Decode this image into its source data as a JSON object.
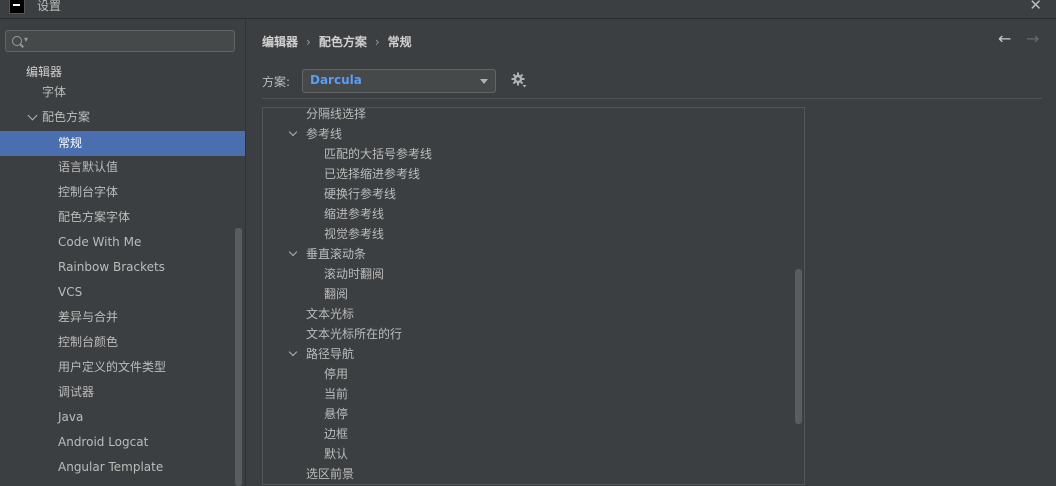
{
  "window": {
    "title": "设置"
  },
  "sidebar": {
    "search": {
      "placeholder": "",
      "value": ""
    },
    "items": [
      {
        "label": "编辑器"
      },
      {
        "label": "字体"
      },
      {
        "label": "配色方案"
      },
      {
        "label": "常规"
      },
      {
        "label": "语言默认值"
      },
      {
        "label": "控制台字体"
      },
      {
        "label": "配色方案字体"
      },
      {
        "label": "Code With Me"
      },
      {
        "label": "Rainbow Brackets"
      },
      {
        "label": "VCS"
      },
      {
        "label": "差异与合并"
      },
      {
        "label": "控制台颜色"
      },
      {
        "label": "用户定义的文件类型"
      },
      {
        "label": "调试器"
      },
      {
        "label": "Java"
      },
      {
        "label": "Android Logcat"
      },
      {
        "label": "Angular Template"
      }
    ],
    "selected": "常规"
  },
  "header": {
    "breadcrumb": [
      "编辑器",
      "配色方案",
      "常规"
    ],
    "separator": "›",
    "back_icon": "←",
    "forward_icon": "→"
  },
  "scheme": {
    "label": "方案:",
    "value": "Darcula"
  },
  "tree": {
    "items": [
      {
        "label": "分隔线选择"
      },
      {
        "label": "参考线"
      },
      {
        "label": "匹配的大括号参考线"
      },
      {
        "label": "已选择缩进参考线"
      },
      {
        "label": "硬换行参考线"
      },
      {
        "label": "缩进参考线"
      },
      {
        "label": "视觉参考线"
      },
      {
        "label": "垂直滚动条"
      },
      {
        "label": "滚动时翻阅"
      },
      {
        "label": "翻阅"
      },
      {
        "label": "文本光标"
      },
      {
        "label": "文本光标所在的行"
      },
      {
        "label": "路径导航"
      },
      {
        "label": "停用"
      },
      {
        "label": "当前"
      },
      {
        "label": "悬停"
      },
      {
        "label": "边框"
      },
      {
        "label": "默认"
      },
      {
        "label": "选区前景"
      }
    ]
  },
  "colors": {
    "background": "#3c3f41",
    "selection": "#4b6eaf",
    "accent_text": "#589df6"
  }
}
